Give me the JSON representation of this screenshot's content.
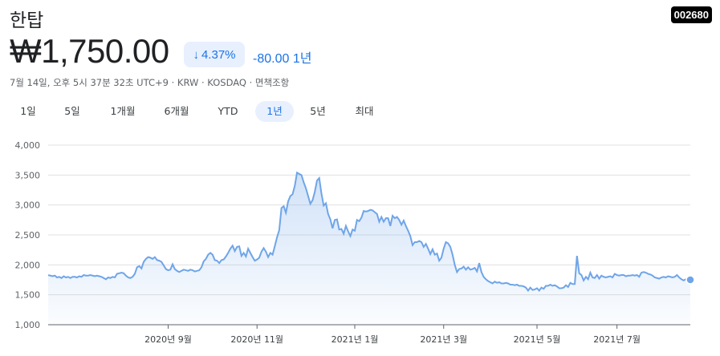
{
  "stock": {
    "name": "한탑",
    "ticker": "002680",
    "price": "₩1,750.00",
    "change_pct": "4.37%",
    "change_abs": "-80.00",
    "period": "1년",
    "meta": "7월 14일, 오후 5시 37분 32초 UTC+9 · KRW · KOSDAQ · 면책조항",
    "trend_color": "#1a73e8",
    "line_color": "#6fa5e8"
  },
  "tabs": [
    "1일",
    "5일",
    "1개월",
    "6개월",
    "YTD",
    "1년",
    "5년",
    "최대"
  ],
  "active_tab": "1년",
  "chart_data": {
    "type": "area",
    "ylim": [
      1000,
      4000
    ],
    "yticks": [
      "4,000",
      "3,500",
      "3,000",
      "2,500",
      "2,000",
      "1,500",
      "1,000"
    ],
    "ytick_values": [
      4000,
      3500,
      3000,
      2500,
      2000,
      1500,
      1000
    ],
    "xticks": [
      "2020년 9월",
      "2020년 11월",
      "2021년 1월",
      "2021년 3월",
      "2021년 5월",
      "2021년 7월"
    ],
    "x_tick_index": [
      54,
      94,
      138,
      178,
      220,
      256
    ],
    "values": [
      1830,
      1820,
      1810,
      1820,
      1790,
      1800,
      1780,
      1810,
      1790,
      1800,
      1780,
      1800,
      1800,
      1790,
      1810,
      1800,
      1830,
      1820,
      1820,
      1830,
      1820,
      1810,
      1820,
      1810,
      1800,
      1780,
      1760,
      1790,
      1780,
      1800,
      1790,
      1850,
      1860,
      1870,
      1860,
      1820,
      1790,
      1780,
      1800,
      1850,
      1960,
      1980,
      1940,
      2050,
      2100,
      2130,
      2120,
      2100,
      2130,
      2080,
      2070,
      2050,
      1990,
      1930,
      1910,
      1920,
      2010,
      1930,
      1900,
      1880,
      1900,
      1920,
      1910,
      1900,
      1920,
      1910,
      1890,
      1900,
      1910,
      1960,
      2060,
      2100,
      2170,
      2200,
      2170,
      2080,
      2070,
      2030,
      2080,
      2090,
      2140,
      2200,
      2270,
      2320,
      2230,
      2300,
      2310,
      2150,
      2200,
      2140,
      2270,
      2200,
      2130,
      2070,
      2090,
      2120,
      2220,
      2280,
      2220,
      2130,
      2200,
      2170,
      2310,
      2460,
      2580,
      2950,
      2980,
      2870,
      3060,
      3150,
      3180,
      3320,
      3540,
      3520,
      3500,
      3380,
      3280,
      3150,
      3020,
      3080,
      3220,
      3410,
      3450,
      3190,
      2990,
      3030,
      2850,
      2760,
      2610,
      2750,
      2760,
      2590,
      2600,
      2520,
      2650,
      2560,
      2480,
      2590,
      2570,
      2750,
      2730,
      2790,
      2900,
      2890,
      2900,
      2920,
      2910,
      2880,
      2850,
      2720,
      2800,
      2720,
      2780,
      2780,
      2650,
      2820,
      2780,
      2800,
      2750,
      2670,
      2740,
      2650,
      2570,
      2480,
      2330,
      2380,
      2380,
      2400,
      2380,
      2300,
      2350,
      2270,
      2180,
      2260,
      2170,
      2190,
      2070,
      2120,
      2270,
      2380,
      2360,
      2300,
      2170,
      2000,
      1880,
      1930,
      1940,
      1970,
      1920,
      1960,
      1920,
      1930,
      1950,
      1890,
      2030,
      1880,
      1800,
      1760,
      1730,
      1710,
      1690,
      1720,
      1700,
      1710,
      1690,
      1690,
      1700,
      1690,
      1670,
      1670,
      1660,
      1670,
      1650,
      1650,
      1640,
      1620,
      1570,
      1620,
      1580,
      1590,
      1610,
      1570,
      1620,
      1600,
      1650,
      1650,
      1670,
      1650,
      1660,
      1640,
      1610,
      1610,
      1620,
      1660,
      1630,
      1700,
      1680,
      1680,
      2150,
      1860,
      1830,
      1740,
      1800,
      1760,
      1870,
      1790,
      1780,
      1830,
      1770,
      1820,
      1800,
      1790,
      1800,
      1810,
      1790,
      1850,
      1830,
      1820,
      1830,
      1830,
      1810,
      1820,
      1820,
      1830,
      1820,
      1830,
      1800,
      1870,
      1880,
      1870,
      1850,
      1840,
      1820,
      1790,
      1780,
      1770,
      1790,
      1800,
      1790,
      1810,
      1800,
      1790,
      1800,
      1830,
      1790,
      1760,
      1740,
      1760,
      1770,
      1750
    ]
  }
}
